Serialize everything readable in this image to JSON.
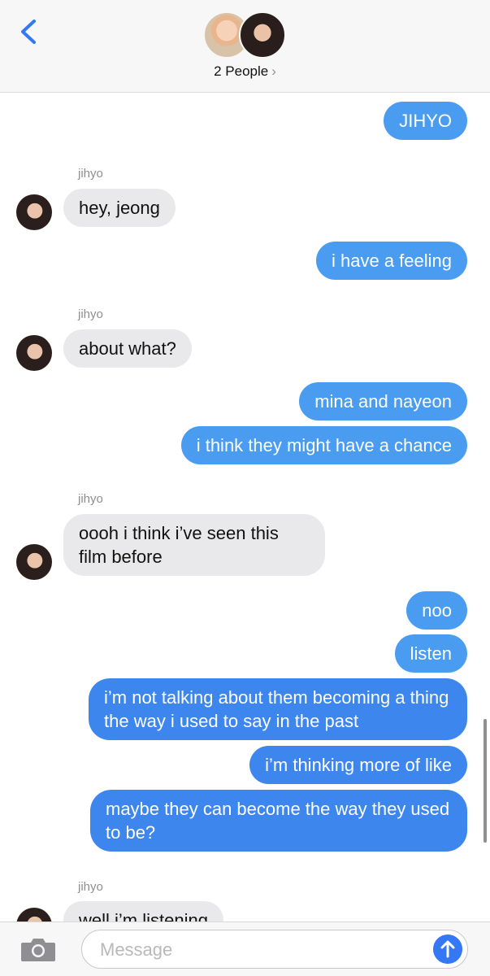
{
  "header": {
    "title": "2 People",
    "chevron": "›"
  },
  "messages": [
    {
      "text": "JIHYO"
    },
    {
      "sender": "jihyo",
      "text": "hey, jeong"
    },
    {
      "text": "i have a feeling"
    },
    {
      "sender": "jihyo",
      "text": "about what?"
    },
    {
      "text": "mina and nayeon"
    },
    {
      "text": "i think they might have a chance"
    },
    {
      "sender": "jihyo",
      "text": "oooh i think i’ve seen this film before"
    },
    {
      "text": "noo"
    },
    {
      "text": "listen"
    },
    {
      "text": "i’m not talking about them becoming a thing the way i used to say in the past"
    },
    {
      "text": "i’m thinking more of like"
    },
    {
      "text": "maybe they can become the way they used to be?"
    },
    {
      "sender": "jihyo",
      "text": "well i’m listening"
    }
  ],
  "composer": {
    "placeholder": "Message",
    "value": ""
  },
  "icons": {
    "back": "chevron-left-icon",
    "camera": "camera-icon",
    "send": "send-arrow-icon"
  },
  "colors": {
    "outgoing_bubble": "#4a9cf0",
    "incoming_bubble": "#e9e9eb",
    "accent": "#3478f6"
  }
}
